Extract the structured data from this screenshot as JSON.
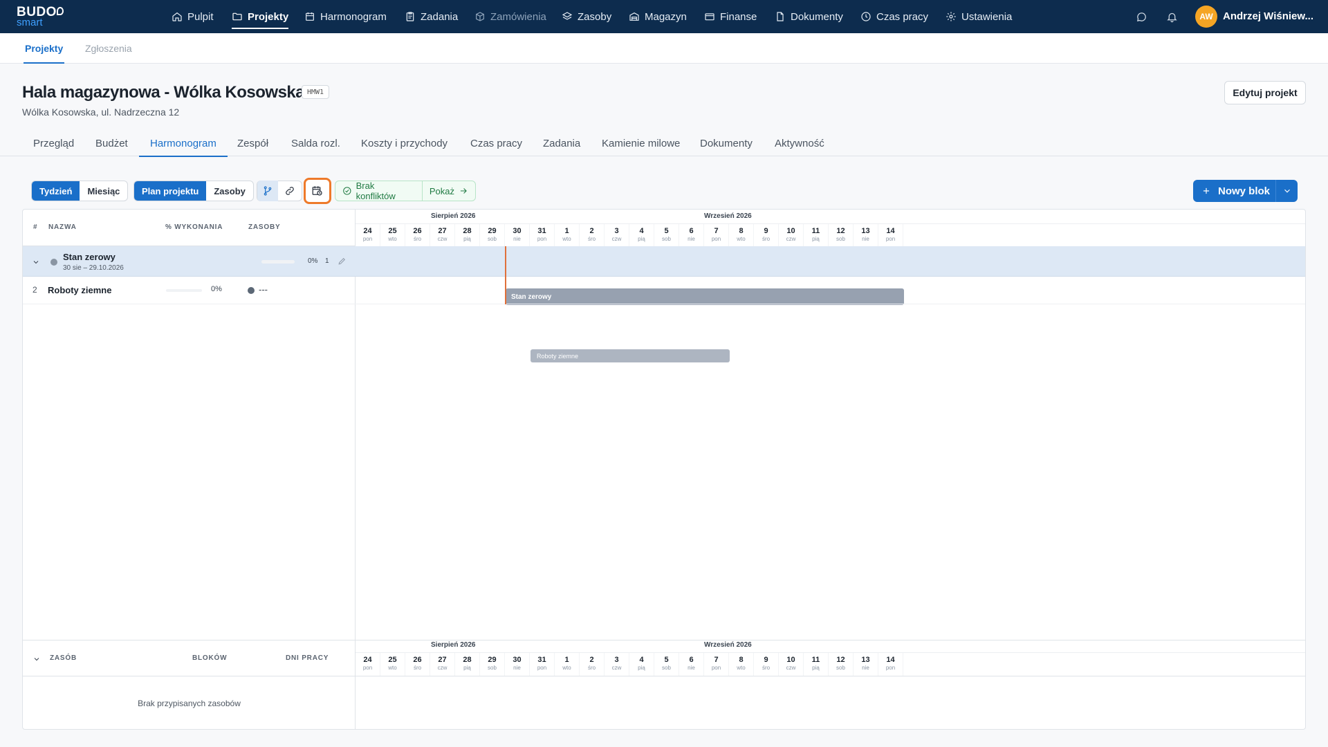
{
  "brand": {
    "line1": "BUDO",
    "line2": "smart"
  },
  "topnav": {
    "items": [
      {
        "label": "Pulpit",
        "icon": "home-icon"
      },
      {
        "label": "Projekty",
        "icon": "folder-icon"
      },
      {
        "label": "Harmonogram",
        "icon": "calendar-icon"
      },
      {
        "label": "Zadania",
        "icon": "clipboard-icon"
      },
      {
        "label": "Zamówienia",
        "icon": "box-icon"
      },
      {
        "label": "Zasoby",
        "icon": "layers-icon"
      },
      {
        "label": "Magazyn",
        "icon": "warehouse-icon"
      },
      {
        "label": "Finanse",
        "icon": "card-icon"
      },
      {
        "label": "Dokumenty",
        "icon": "document-icon"
      },
      {
        "label": "Czas pracy",
        "icon": "clock-icon"
      },
      {
        "label": "Ustawienia",
        "icon": "gear-icon"
      }
    ],
    "user_initials": "AW",
    "user_name": "Andrzej Wiśniew..."
  },
  "subnav": {
    "tabs": [
      "Projekty",
      "Zgłoszenia"
    ]
  },
  "project": {
    "title": "Hala magazynowa - Wólka Kosowska",
    "code": "HMW1",
    "address": "Wólka Kosowska, ul. Nadrzeczna 12",
    "edit_label": "Edytuj projekt"
  },
  "project_tabs": [
    "Przegląd",
    "Budżet",
    "Harmonogram",
    "Zespół",
    "Salda rozl.",
    "Koszty i przychody",
    "Czas pracy",
    "Zadania",
    "Kamienie milowe",
    "Dokumenty",
    "Aktywność"
  ],
  "toolbar": {
    "period": [
      "Tydzień",
      "Miesiąc"
    ],
    "view": [
      "Plan projektu",
      "Zasoby"
    ],
    "conflicts_label": "Brak konfliktów",
    "show_label": "Pokaż",
    "new_block_label": "Nowy blok"
  },
  "columns": {
    "num": "#",
    "name": "NAZWA",
    "progress": "% WYKONANIA",
    "resources": "ZASOBY"
  },
  "timeline": {
    "months": [
      "Sierpień 2026",
      "Wrzesień 2026"
    ],
    "days": [
      {
        "d": "24",
        "w": "pon"
      },
      {
        "d": "25",
        "w": "wto"
      },
      {
        "d": "26",
        "w": "śro"
      },
      {
        "d": "27",
        "w": "czw"
      },
      {
        "d": "28",
        "w": "pią"
      },
      {
        "d": "29",
        "w": "sob"
      },
      {
        "d": "30",
        "w": "nie"
      },
      {
        "d": "31",
        "w": "pon"
      },
      {
        "d": "1",
        "w": "wto"
      },
      {
        "d": "2",
        "w": "śro"
      },
      {
        "d": "3",
        "w": "czw"
      },
      {
        "d": "4",
        "w": "pią"
      },
      {
        "d": "5",
        "w": "sob"
      },
      {
        "d": "6",
        "w": "nie"
      },
      {
        "d": "7",
        "w": "pon"
      },
      {
        "d": "8",
        "w": "wto"
      },
      {
        "d": "9",
        "w": "śro"
      },
      {
        "d": "10",
        "w": "czw"
      },
      {
        "d": "11",
        "w": "pią"
      },
      {
        "d": "12",
        "w": "sob"
      },
      {
        "d": "13",
        "w": "nie"
      },
      {
        "d": "14",
        "w": "pon"
      }
    ]
  },
  "group": {
    "name": "Stan zerowy",
    "dates": "30 sie – 29.10.2026",
    "progress": "0%",
    "count": "1",
    "bar_label": "Stan zerowy"
  },
  "task": {
    "num": "2",
    "name": "Roboty ziemne",
    "progress": "0%",
    "resources": "---",
    "bar_label": "Roboty ziemne"
  },
  "resources_panel": {
    "col_resource": "ZASÓB",
    "col_blocks": "BLOKÓW",
    "col_days": "DNI PRACY",
    "empty_text": "Brak przypisanych zasobów"
  }
}
